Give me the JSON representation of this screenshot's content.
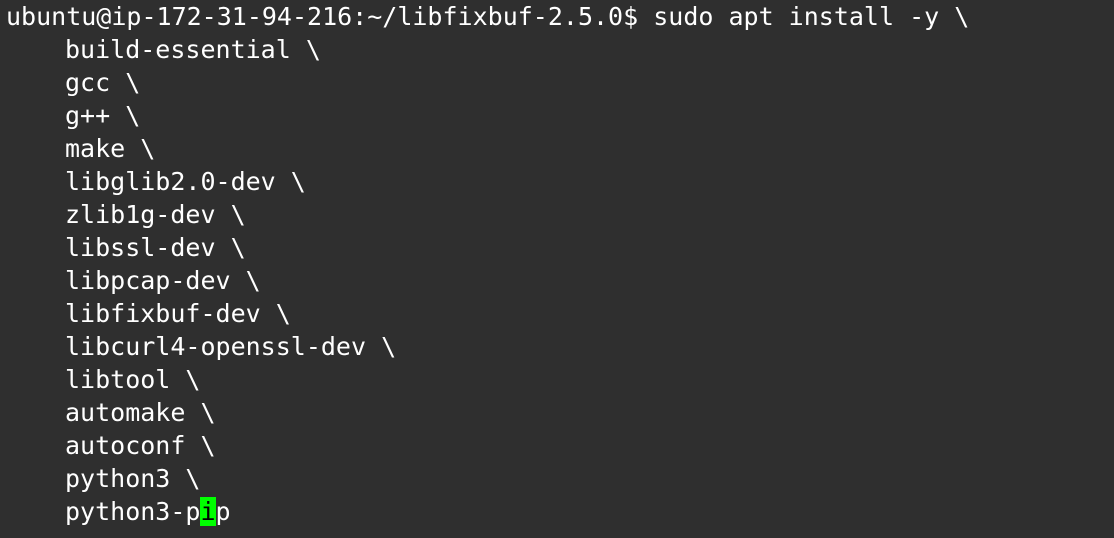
{
  "terminal": {
    "prompt": "ubuntu@ip-172-31-94-216:~/libfixbuf-2.5.0$",
    "command": "sudo apt install -y \\",
    "continuation_lines": [
      "build-essential \\",
      "gcc \\",
      "g++ \\",
      "make \\",
      "libglib2.0-dev \\",
      "zlib1g-dev \\",
      "libssl-dev \\",
      "libpcap-dev \\",
      "libfixbuf-dev \\",
      "libcurl4-openssl-dev \\",
      "libtool \\",
      "automake \\",
      "autoconf \\",
      "python3 \\"
    ],
    "last_line": {
      "before_cursor": "python3-p",
      "cursor_char": "i",
      "after_cursor": "p"
    },
    "colors": {
      "background": "#2f2f2f",
      "foreground": "#ffffff",
      "cursor": "#00ff00"
    }
  }
}
